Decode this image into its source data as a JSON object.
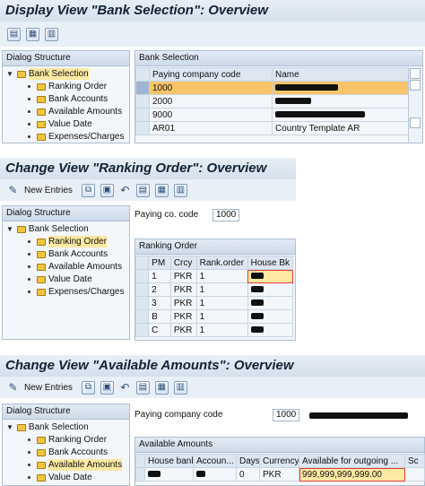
{
  "screen1": {
    "title": "Display View \"Bank Selection\": Overview",
    "toolbar_icons": [
      "details-icon",
      "select-all-icon",
      "deselect-all-icon"
    ],
    "tree_header": "Dialog Structure",
    "tree": [
      {
        "label": "Bank Selection",
        "level": 0,
        "selected": true
      },
      {
        "label": "Ranking Order",
        "level": 1
      },
      {
        "label": "Bank Accounts",
        "level": 1
      },
      {
        "label": "Available Amounts",
        "level": 1
      },
      {
        "label": "Value Date",
        "level": 1
      },
      {
        "label": "Expenses/Charges",
        "level": 1
      }
    ],
    "table_title": "Bank Selection",
    "columns": [
      "Paying company code",
      "Name"
    ],
    "rows": [
      {
        "code": "1000",
        "name": "",
        "redacted": true,
        "selected": true
      },
      {
        "code": "2000",
        "name": "",
        "redacted": true
      },
      {
        "code": "9000",
        "name": "",
        "redacted": true
      },
      {
        "code": "AR01",
        "name": "Country Template AR",
        "redacted": false
      }
    ]
  },
  "screen2": {
    "title": "Change View \"Ranking Order\": Overview",
    "new_entries_label": "New Entries",
    "tree_header": "Dialog Structure",
    "tree": [
      {
        "label": "Bank Selection",
        "level": 0
      },
      {
        "label": "Ranking Order",
        "level": 1,
        "selected": true
      },
      {
        "label": "Bank Accounts",
        "level": 1
      },
      {
        "label": "Available Amounts",
        "level": 1
      },
      {
        "label": "Value Date",
        "level": 1
      },
      {
        "label": "Expenses/Charges",
        "level": 1
      }
    ],
    "company_label": "Paying co. code",
    "company_value": "1000",
    "table_title": "Ranking Order",
    "columns": [
      "PM",
      "Crcy",
      "Rank.order",
      "House Bk"
    ],
    "rows": [
      [
        "1",
        "PKR",
        "1",
        ""
      ],
      [
        "2",
        "PKR",
        "1",
        ""
      ],
      [
        "3",
        "PKR",
        "1",
        ""
      ],
      [
        "B",
        "PKR",
        "1",
        ""
      ],
      [
        "C",
        "PKR",
        "1",
        ""
      ]
    ]
  },
  "screen3": {
    "title": "Change View \"Available Amounts\": Overview",
    "new_entries_label": "New Entries",
    "tree_header": "Dialog Structure",
    "tree": [
      {
        "label": "Bank Selection",
        "level": 0
      },
      {
        "label": "Ranking Order",
        "level": 1
      },
      {
        "label": "Bank Accounts",
        "level": 1
      },
      {
        "label": "Available Amounts",
        "level": 1,
        "selected": true
      },
      {
        "label": "Value Date",
        "level": 1
      }
    ],
    "company_label": "Paying company code",
    "company_value": "1000",
    "table_title": "Available Amounts",
    "columns": [
      "House bank",
      "Accoun...",
      "Days",
      "Currency",
      "Available for outgoing ...",
      "Sc"
    ],
    "rows": [
      [
        "",
        "",
        "0",
        "PKR",
        "999,999,999,999.00",
        ""
      ]
    ]
  }
}
